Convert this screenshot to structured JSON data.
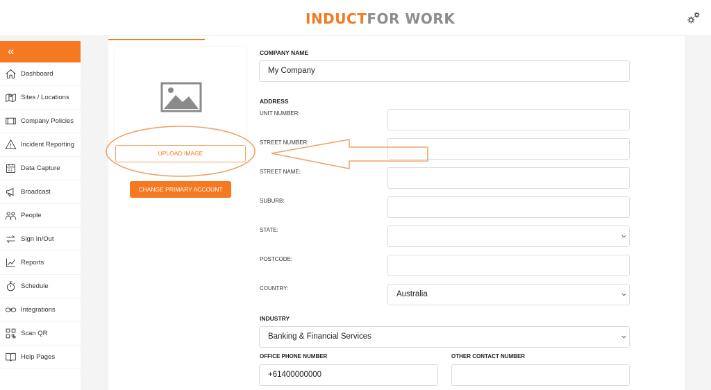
{
  "header": {
    "logo_part1": "INDUCT",
    "logo_part2": "FOR WORK",
    "settings_icon": "gears-icon"
  },
  "sidebar": {
    "collapse_label": "«",
    "items": [
      {
        "label": "Dashboard",
        "icon": "home-icon"
      },
      {
        "label": "Sites / Locations",
        "icon": "map-icon"
      },
      {
        "label": "Company Policies",
        "icon": "film-icon"
      },
      {
        "label": "Incident Reporting",
        "icon": "warning-icon"
      },
      {
        "label": "Data Capture",
        "icon": "calendar-icon"
      },
      {
        "label": "Broadcast",
        "icon": "megaphone-icon"
      },
      {
        "label": "People",
        "icon": "people-icon"
      },
      {
        "label": "Sign In/Out",
        "icon": "swap-icon"
      },
      {
        "label": "Reports",
        "icon": "chart-icon"
      },
      {
        "label": "Schedule",
        "icon": "stopwatch-icon"
      },
      {
        "label": "Integrations",
        "icon": "link-icon"
      },
      {
        "label": "Scan QR",
        "icon": "qr-icon"
      },
      {
        "label": "Help Pages",
        "icon": "book-icon"
      }
    ]
  },
  "logo_panel": {
    "image_icon": "image-placeholder-icon",
    "upload_label": "UPLOAD IMAGE",
    "primary_account_label": "CHANGE PRIMARY ACCOUNT"
  },
  "form": {
    "company_name_label": "COMPANY NAME",
    "company_name_value": "My Company",
    "address_label": "ADDRESS",
    "unit_number_label": "UNIT NUMBER:",
    "street_number_label": "STREET NUMBER:",
    "street_name_label": "STREET NAME:",
    "suburb_label": "SUBURB:",
    "state_label": "STATE:",
    "state_value": "",
    "postcode_label": "POSTCODE:",
    "country_label": "COUNTRY:",
    "country_value": "Australia",
    "industry_label": "INDUSTRY",
    "industry_value": "Banking & Financial Services",
    "office_phone_label": "OFFICE PHONE NUMBER",
    "office_phone_value": "+61400000000",
    "other_contact_label": "OTHER CONTACT NUMBER",
    "other_contact_value": ""
  },
  "colors": {
    "accent": "#f47920",
    "logo_grey": "#8d8d8d"
  }
}
